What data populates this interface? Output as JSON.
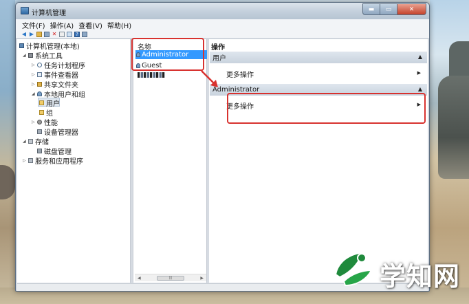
{
  "window": {
    "title": "计算机管理",
    "controls": {
      "minimize": "▬",
      "maximize": "▭",
      "close": "✕"
    }
  },
  "menu": [
    "文件(F)",
    "操作(A)",
    "查看(V)",
    "帮助(H)"
  ],
  "toolbar": {
    "icons": [
      "back-arrow-icon",
      "forward-arrow-icon",
      "folder-icon",
      "grid-icon",
      "delete-x-icon",
      "properties-icon",
      "refresh-icon",
      "help-icon",
      "view-icon"
    ]
  },
  "tree": {
    "root": "计算机管理(本地)",
    "system_tools": "系统工具",
    "task_scheduler": "任务计划程序",
    "event_viewer": "事件查看器",
    "shared_folders": "共享文件夹",
    "local_users_groups": "本地用户和组",
    "users": "用户",
    "groups": "组",
    "performance": "性能",
    "device_manager": "设备管理器",
    "storage": "存储",
    "disk_management": "磁盘管理",
    "services_apps": "服务和应用程序"
  },
  "list": {
    "header": "名称",
    "rows": [
      "Administrator",
      "Guest"
    ],
    "selected_index": 0
  },
  "actions": {
    "title": "操作",
    "sections": [
      {
        "name": "用户",
        "link": "更多操作"
      },
      {
        "name": "Administrator",
        "link": "更多操作"
      }
    ]
  },
  "watermark": {
    "text": "学知网"
  },
  "colors": {
    "selection": "#3399ff",
    "annotation": "#d8322f",
    "watermark_green": "#1f8a3c"
  }
}
